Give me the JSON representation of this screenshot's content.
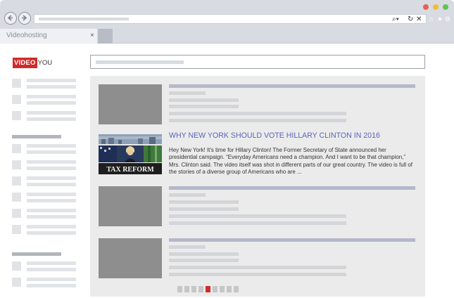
{
  "browser": {
    "tab_title": "Videohosting",
    "tab_close": "×",
    "window_controls": [
      "#e66152",
      "#f3bd34",
      "#61c454"
    ],
    "nav_icons": [
      "back-arrow-icon",
      "forward-arrow-icon"
    ],
    "address_icons": {
      "search": "⌕▾",
      "reload": "↻",
      "close": "✕"
    }
  },
  "logo": {
    "red_part": "VIDEO",
    "rest": "YOU",
    "accent": "#d12a2a"
  },
  "feed": {
    "featured": {
      "title": "WHY NEW YORK SHOULD VOTE HILLARY CLINTON IN 2016",
      "thumbnail_caption": "TAX REFORM",
      "description": "Hey New York! It's time for Hillary Clinton! The Former Secretary of State announced her presidential campaign. “Everyday Americans need a champion. And I want to be that champion,” Mrs. Clinton said. The video itself was shot in different parts of our great country. The video is full of the stories of a diverse group of Americans who are ..."
    },
    "pagination": {
      "pages": 9,
      "active": 5,
      "active_color": "#d22a2a"
    },
    "title_color": "#5a66b8"
  }
}
